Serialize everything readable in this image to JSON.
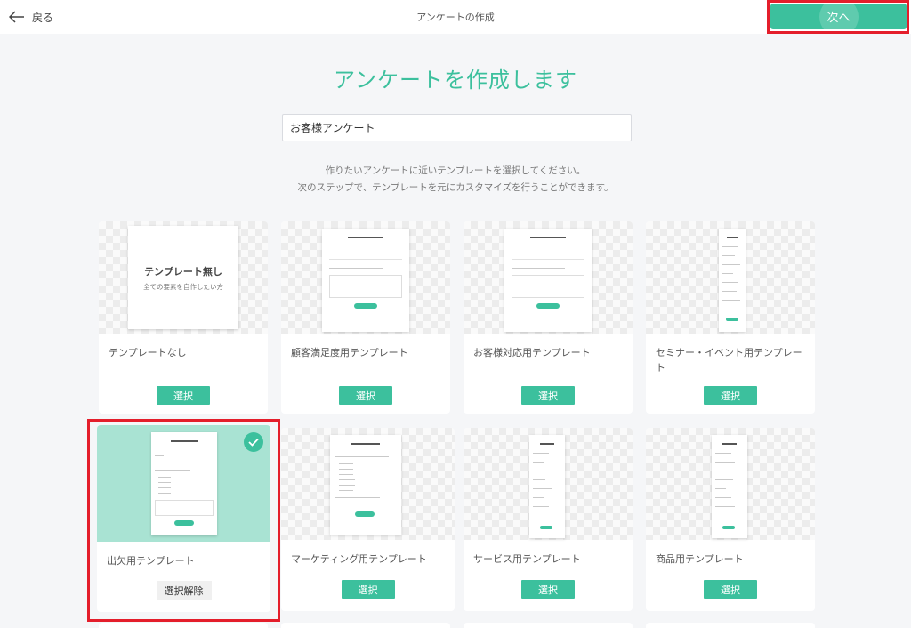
{
  "topbar": {
    "back_label": "戻る",
    "title": "アンケートの作成",
    "next_label": "次へ"
  },
  "main": {
    "heading": "アンケートを作成します",
    "name_input_value": "お客様アンケート",
    "description_line1": "作りたいアンケートに近いテンプレートを選択してください。",
    "description_line2": "次のステップで、テンプレートを元にカスタマイズを行うことができます。"
  },
  "templates": [
    {
      "label": "テンプレートなし",
      "button": "選択",
      "preview_title": "テンプレート無し",
      "preview_subtitle": "全ての要素を自作したい方"
    },
    {
      "label": "顧客満足度用テンプレート",
      "button": "選択"
    },
    {
      "label": "お客様対応用テンプレート",
      "button": "選択"
    },
    {
      "label": "セミナー・イベント用テンプレート",
      "button": "選択"
    },
    {
      "label": "出欠用テンプレート",
      "button": "選択解除",
      "selected": true
    },
    {
      "label": "マーケティング用テンプレート",
      "button": "選択"
    },
    {
      "label": "サービス用テンプレート",
      "button": "選択"
    },
    {
      "label": "商品用テンプレート",
      "button": "選択"
    }
  ],
  "colors": {
    "accent": "#3cc09d",
    "selected_bg": "#a9e3d3",
    "highlight": "#e41e2b"
  }
}
